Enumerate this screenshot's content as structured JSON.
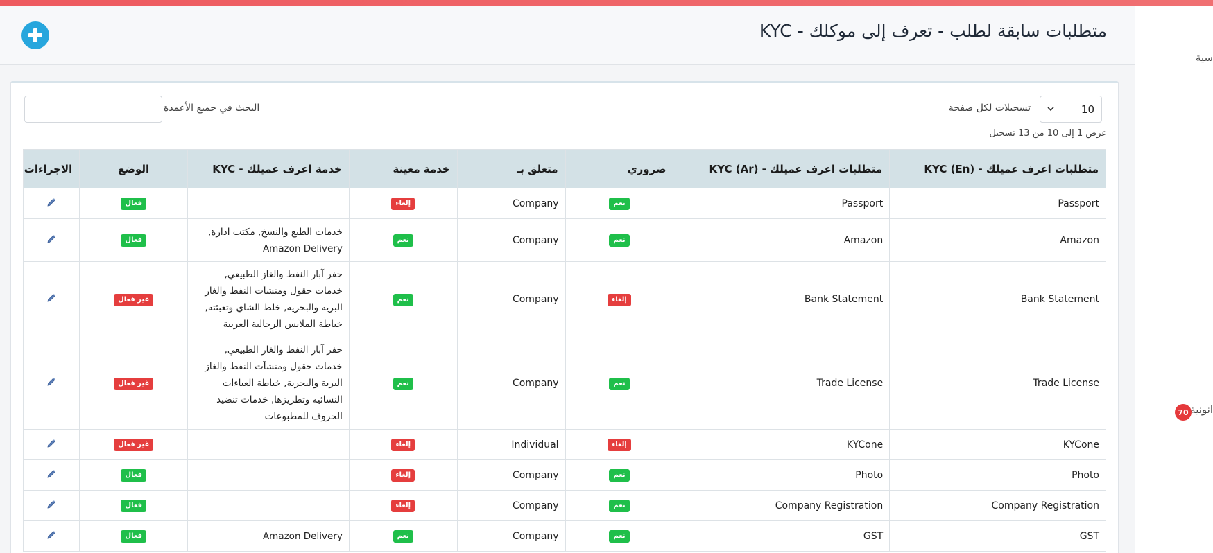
{
  "header": {
    "title": "متطلبات سابقة لطلب - تعرف إلى موكلك - KYC",
    "add_icon": "plus-circle-icon"
  },
  "sidebar": {
    "item1_text": "سية",
    "item2_text": "انونية",
    "badge_count": "70"
  },
  "controls": {
    "page_length_value": "10",
    "page_length_label": "تسجيلات لكل صفحة",
    "search_label": "البحث في جميع الأعمدة",
    "search_value": "",
    "info": "عرض 1 إلى 10 من 13 تسجيل"
  },
  "table": {
    "headers": {
      "name_en": "متطلبات اعرف عميلك - KYC (En)",
      "name_ar": "متطلبات اعرف عميلك - KYC (Ar)",
      "required": "ضروري",
      "related_to": "متعلق بـ",
      "specific_service": "خدمة معينة",
      "kyc_service": "خدمة اعرف عميلك - KYC",
      "status": "الوضع",
      "actions": "الاجراءات"
    },
    "rows": [
      {
        "name_en": "Passport",
        "name_ar": "Passport",
        "required": "نعم",
        "required_color": "green",
        "related_to": "Company",
        "specific": "إلغاء",
        "specific_color": "red",
        "services": "",
        "status": "فعال",
        "status_color": "green"
      },
      {
        "name_en": "Amazon",
        "name_ar": "Amazon",
        "required": "نعم",
        "required_color": "green",
        "related_to": "Company",
        "specific": "نعم",
        "specific_color": "green",
        "services": "خدمات الطبع والنسخ, مكتب ادارة, Amazon Delivery",
        "status": "فعال",
        "status_color": "green"
      },
      {
        "name_en": "Bank Statement",
        "name_ar": "Bank Statement",
        "required": "إلغاء",
        "required_color": "red",
        "related_to": "Company",
        "specific": "نعم",
        "specific_color": "green",
        "services": "حفر آبار النفط والغاز الطبيعي, خدمات حقول ومنشآت النفط والغاز البرية والبحرية, خلط الشاي وتعبئته, خياطة الملابس الرجالية العربية",
        "status": "غير فعال",
        "status_color": "red"
      },
      {
        "name_en": "Trade License",
        "name_ar": "Trade License",
        "required": "نعم",
        "required_color": "green",
        "related_to": "Company",
        "specific": "نعم",
        "specific_color": "green",
        "services": "حفر آبار النفط والغاز الطبيعي, خدمات حقول ومنشآت النفط والغاز البرية والبحرية, خياطة العباءات النسائية وتطريزها, خدمات تنضيد الحروف للمطبوعات",
        "status": "غير فعال",
        "status_color": "red"
      },
      {
        "name_en": "KYCone",
        "name_ar": "KYCone",
        "required": "إلغاء",
        "required_color": "red",
        "related_to": "Individual",
        "specific": "إلغاء",
        "specific_color": "red",
        "services": "",
        "status": "غير فعال",
        "status_color": "red"
      },
      {
        "name_en": "Photo",
        "name_ar": "Photo",
        "required": "نعم",
        "required_color": "green",
        "related_to": "Company",
        "specific": "إلغاء",
        "specific_color": "red",
        "services": "",
        "status": "فعال",
        "status_color": "green"
      },
      {
        "name_en": "Company Registration",
        "name_ar": "Company Registration",
        "required": "نعم",
        "required_color": "green",
        "related_to": "Company",
        "specific": "إلغاء",
        "specific_color": "red",
        "services": "",
        "status": "فعال",
        "status_color": "green"
      },
      {
        "name_en": "GST",
        "name_ar": "GST",
        "required": "نعم",
        "required_color": "green",
        "related_to": "Company",
        "specific": "نعم",
        "specific_color": "green",
        "services": "Amazon Delivery",
        "status": "فعال",
        "status_color": "green"
      }
    ],
    "edit_icon": "pencil-icon"
  },
  "colors": {
    "accent": "#27a6dd",
    "top_bar": "#ee5a5f",
    "header_bg": "#d3e1e6",
    "badge_green": "#1fbf4a",
    "badge_red": "#e53e3e"
  }
}
